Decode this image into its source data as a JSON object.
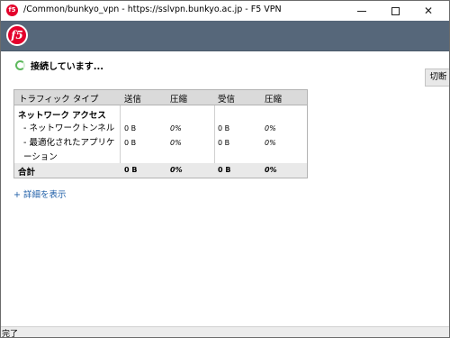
{
  "window": {
    "title": "/Common/bunkyo_vpn - https://sslvpn.bunkyo.ac.jp - F5 VPN",
    "app_icon": "f5-icon",
    "controls": [
      "minimize-icon",
      "maximize-icon",
      "close-icon"
    ]
  },
  "header": {
    "logo_text": "f5",
    "background": "#56677a"
  },
  "status": {
    "text": "接続しています...",
    "icon": "spinner-icon"
  },
  "disconnect_label": "切断",
  "table": {
    "headers": {
      "type": "トラフィック タイプ",
      "sent": "送信",
      "sent_compression": "圧縮",
      "received": "受信",
      "received_compression": "圧縮"
    },
    "group": "ネットワーク アクセス",
    "rows": [
      {
        "label": "- ネットワークトンネル",
        "sent": "0 B",
        "sent_compression": "0%",
        "received": "0 B",
        "received_compression": "0%"
      },
      {
        "label": "- 最適化されたアプリケーション",
        "sent": "0 B",
        "sent_compression": "0%",
        "received": "0 B",
        "received_compression": "0%"
      }
    ],
    "total": {
      "label": "合計",
      "sent": "0 B",
      "sent_compression": "0%",
      "received": "0 B",
      "received_compression": "0%"
    }
  },
  "details_link": "+ 詳細を表示",
  "statusbar": "完了"
}
